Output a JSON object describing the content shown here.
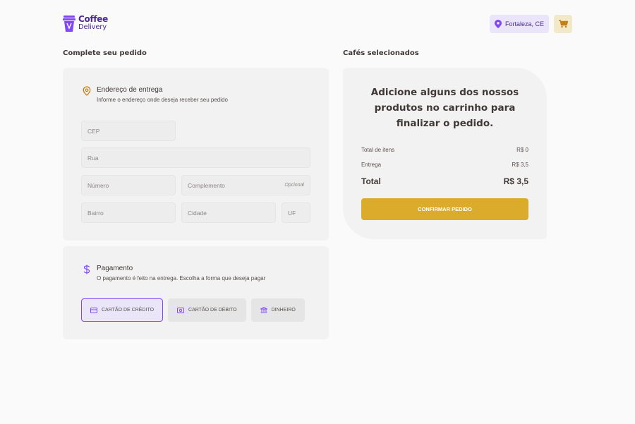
{
  "header": {
    "logo_line1": "Coffee",
    "logo_line2": "Delivery",
    "location": "Fortaleza, CE"
  },
  "address_section_title": "Complete seu pedido",
  "summary_section_title": "Cafés selecionados",
  "address": {
    "title": "Endereço de entrega",
    "subtitle": "Informe o endereço onde deseja receber seu pedido",
    "fields": {
      "cep": "CEP",
      "rua": "Rua",
      "numero": "Número",
      "complemento": "Complemento",
      "complemento_opt": "Opcional",
      "bairro": "Bairro",
      "cidade": "Cidade",
      "uf": "UF"
    }
  },
  "payment": {
    "title": "Pagamento",
    "subtitle": "O pagamento é feito na entrega. Escolha a forma que deseja pagar",
    "options": [
      {
        "label": "CARTÃO DE CRÉDITO",
        "selected": true
      },
      {
        "label": "CARTÃO DE DÉBITO",
        "selected": false
      },
      {
        "label": "DINHEIRO",
        "selected": false
      }
    ]
  },
  "summary": {
    "empty_message": "Adicione alguns dos nossos produtos no carrinho para finalizar o pedido.",
    "items_label": "Total de itens",
    "items_value": "R$ 0",
    "delivery_label": "Entrega",
    "delivery_value": "R$ 3,5",
    "total_label": "Total",
    "total_value": "R$ 3,5",
    "confirm_label": "CONFIRMAR PEDIDO"
  },
  "colors": {
    "purple": "#8047f8",
    "purple_dark": "#4b2995",
    "yellow": "#dbac2c",
    "yellow_dark": "#c47f17",
    "card": "#f3f2f2"
  }
}
